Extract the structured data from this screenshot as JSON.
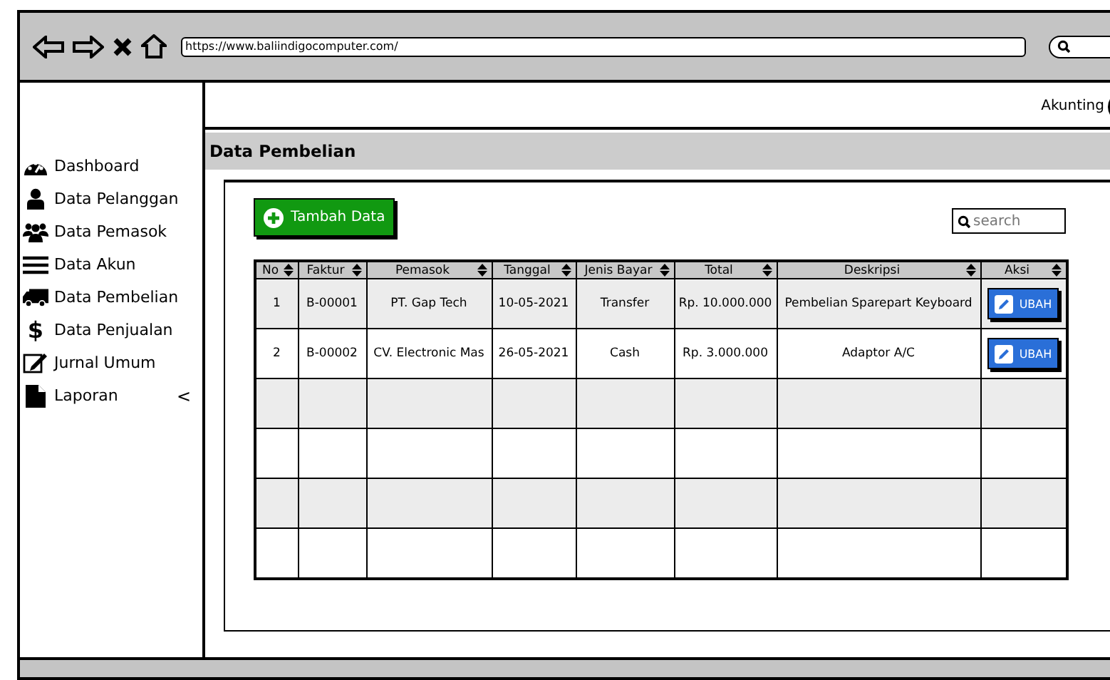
{
  "browser": {
    "url": "https://www.baliindigocomputer.com/"
  },
  "sidebar": {
    "items": [
      {
        "label": "Dashboard"
      },
      {
        "label": "Data Pelanggan"
      },
      {
        "label": "Data Pemasok"
      },
      {
        "label": "Data Akun"
      },
      {
        "label": "Data Pembelian"
      },
      {
        "label": "Data Penjualan",
        "glyph": "$"
      },
      {
        "label": "Jurnal Umum"
      },
      {
        "label": "Laporan",
        "caret": "<"
      }
    ]
  },
  "header": {
    "user": "Akunting"
  },
  "section_title": "Data Pembelian",
  "add_button": "Tambah Data",
  "search": {
    "placeholder": "search"
  },
  "table": {
    "columns": [
      "No",
      "Faktur",
      "Pemasok",
      "Tanggal",
      "Jenis Bayar",
      "Total",
      "Deskripsi",
      "Aksi"
    ],
    "rows": [
      {
        "cells": [
          "1",
          "B-00001",
          "PT. Gap Tech",
          "10-05-2021",
          "Transfer",
          "Rp. 10.000.000",
          "Pembelian Sparepart Keyboard"
        ],
        "action": "UBAH"
      },
      {
        "cells": [
          "2",
          "B-00002",
          "CV. Electronic Mas",
          "26-05-2021",
          "Cash",
          "Rp. 3.000.000",
          "Adaptor A/C"
        ],
        "action": "UBAH"
      }
    ]
  }
}
